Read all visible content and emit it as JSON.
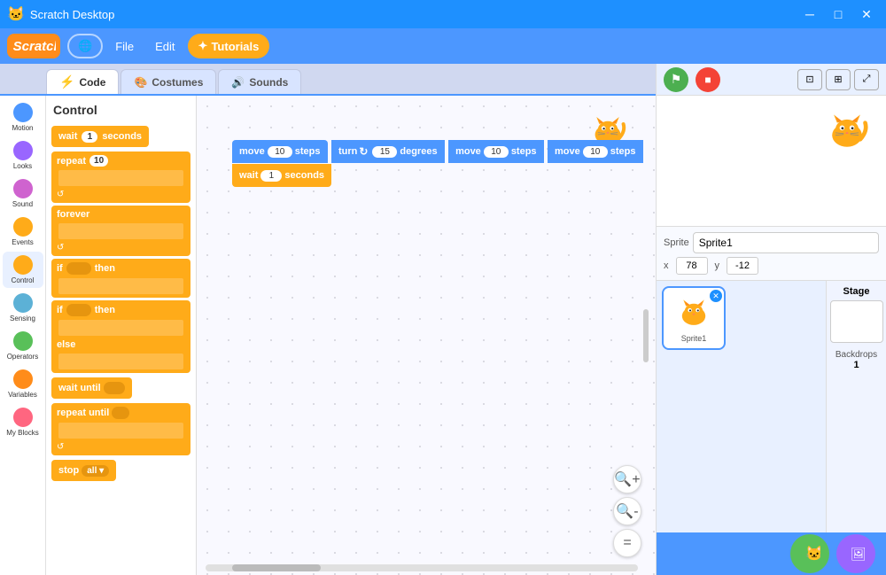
{
  "titlebar": {
    "title": "Scratch Desktop",
    "minimize": "─",
    "maximize": "□",
    "close": "✕"
  },
  "menubar": {
    "logo": "Scratch",
    "globe_label": "🌐",
    "file_label": "File",
    "edit_label": "Edit",
    "tutorials_label": "✦ Tutorials",
    "tutorials_icon": "✦"
  },
  "tabs": {
    "code": "Code",
    "costumes": "Costumes",
    "sounds": "Sounds"
  },
  "categories": [
    {
      "id": "motion",
      "label": "Motion",
      "color": "#4c97ff"
    },
    {
      "id": "looks",
      "label": "Looks",
      "color": "#9966ff"
    },
    {
      "id": "sound",
      "label": "Sound",
      "color": "#cf63cf"
    },
    {
      "id": "events",
      "label": "Events",
      "color": "#ffab19"
    },
    {
      "id": "control",
      "label": "Control",
      "color": "#ffab19"
    },
    {
      "id": "sensing",
      "label": "Sensing",
      "color": "#5cb1d6"
    },
    {
      "id": "operators",
      "label": "Operators",
      "color": "#59c059"
    },
    {
      "id": "variables",
      "label": "Variables",
      "color": "#ff8c1a"
    },
    {
      "id": "myblocks",
      "label": "My Blocks",
      "color": "#ff6680"
    }
  ],
  "blocks_header": "Control",
  "workspace_blocks": [
    {
      "type": "blue",
      "text": "move",
      "input": "10",
      "after": "steps"
    },
    {
      "type": "blue",
      "text": "turn ↻",
      "input": "15",
      "after": "degrees"
    },
    {
      "type": "blue",
      "text": "move",
      "input": "10",
      "after": "steps"
    },
    {
      "type": "blue",
      "text": "move",
      "input": "10",
      "after": "steps"
    },
    {
      "type": "orange",
      "text": "wait",
      "input": "1",
      "after": "seconds"
    }
  ],
  "stage": {
    "sprite_name": "Sprite1",
    "x": "78",
    "y": "-12"
  },
  "stage_panel": {
    "label": "Stage",
    "backdrops_label": "Backdrops",
    "backdrops_count": "1"
  },
  "zoom": {
    "zoom_in": "+",
    "zoom_out": "−",
    "reset": "="
  },
  "bottom": {
    "add_sprite": "+",
    "add_backdrop": "+"
  }
}
